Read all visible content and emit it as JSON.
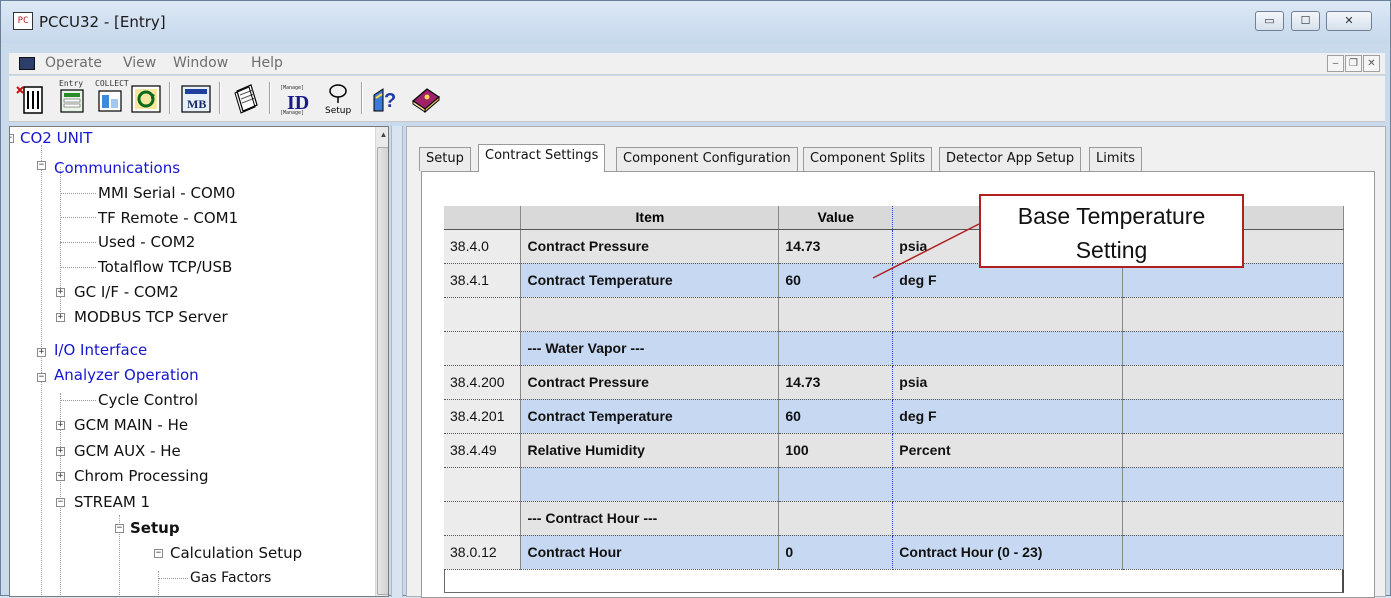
{
  "window": {
    "title": "PCCU32 - [Entry]",
    "min_glyph": "▭",
    "max_glyph": "☐",
    "close_glyph": "✕"
  },
  "menu": {
    "items": [
      "Operate",
      "View",
      "Window",
      "Help"
    ],
    "mdi_min": "–",
    "mdi_restore": "❐",
    "mdi_close": "✕"
  },
  "toolbar": {
    "entry_label": "Entry",
    "collect_label": "COLLECT",
    "setup_label": "Setup",
    "buttons": [
      "entry-icon",
      "collect-icon",
      "refresh-icon",
      "mb-icon",
      "notepad-icon",
      "id-manager-icon",
      "setup-icon",
      "help-icon",
      "manual-icon"
    ]
  },
  "tree": {
    "co2_unit": "CO2 UNIT",
    "communications": "Communications",
    "mmi_serial": "MMI Serial - COM0",
    "tf_remote": "TF Remote - COM1",
    "used_com2": "Used - COM2",
    "totalflow_tcp": "Totalflow TCP/USB",
    "gc_if": "GC I/F - COM2",
    "modbus_tcp": "MODBUS TCP Server",
    "io_interface": "I/O Interface",
    "analyzer_operation": "Analyzer Operation",
    "cycle_control": "Cycle Control",
    "gcm_main": "GCM MAIN - He",
    "gcm_aux": "GCM AUX - He",
    "chrom_processing": "Chrom Processing",
    "stream1": "STREAM 1",
    "setup": "Setup",
    "calc_setup": "Calculation Setup",
    "gas_factors": "Gas Factors"
  },
  "tabs": [
    "Setup",
    "Contract Settings",
    "Component Configuration",
    "Component Splits",
    "Detector App Setup",
    "Limits"
  ],
  "active_tab": "Contract Settings",
  "grid": {
    "headers": [
      "",
      "Item",
      "Value",
      "",
      ""
    ],
    "rows": [
      {
        "num": "38.4.0",
        "item": "Contract Pressure",
        "value": "14.73",
        "unit": "psia"
      },
      {
        "num": "38.4.1",
        "item": "Contract Temperature",
        "value": "60",
        "unit": "deg F"
      },
      {
        "num": "",
        "item": "",
        "value": "",
        "unit": ""
      },
      {
        "num": "",
        "item": "--- Water Vapor ---",
        "value": "",
        "unit": ""
      },
      {
        "num": "38.4.200",
        "item": "Contract Pressure",
        "value": "14.73",
        "unit": "psia"
      },
      {
        "num": "38.4.201",
        "item": "Contract Temperature",
        "value": "60",
        "unit": "deg F"
      },
      {
        "num": "38.4.49",
        "item": "Relative Humidity",
        "value": "100",
        "unit": " Percent"
      },
      {
        "num": "",
        "item": "",
        "value": "",
        "unit": ""
      },
      {
        "num": "",
        "item": "--- Contract Hour ---",
        "value": "",
        "unit": ""
      },
      {
        "num": "38.0.12",
        "item": "Contract Hour",
        "value": "0",
        "unit": " Contract Hour (0 - 23)"
      }
    ]
  },
  "callout": {
    "line1": "Base Temperature",
    "line2": "Setting"
  }
}
